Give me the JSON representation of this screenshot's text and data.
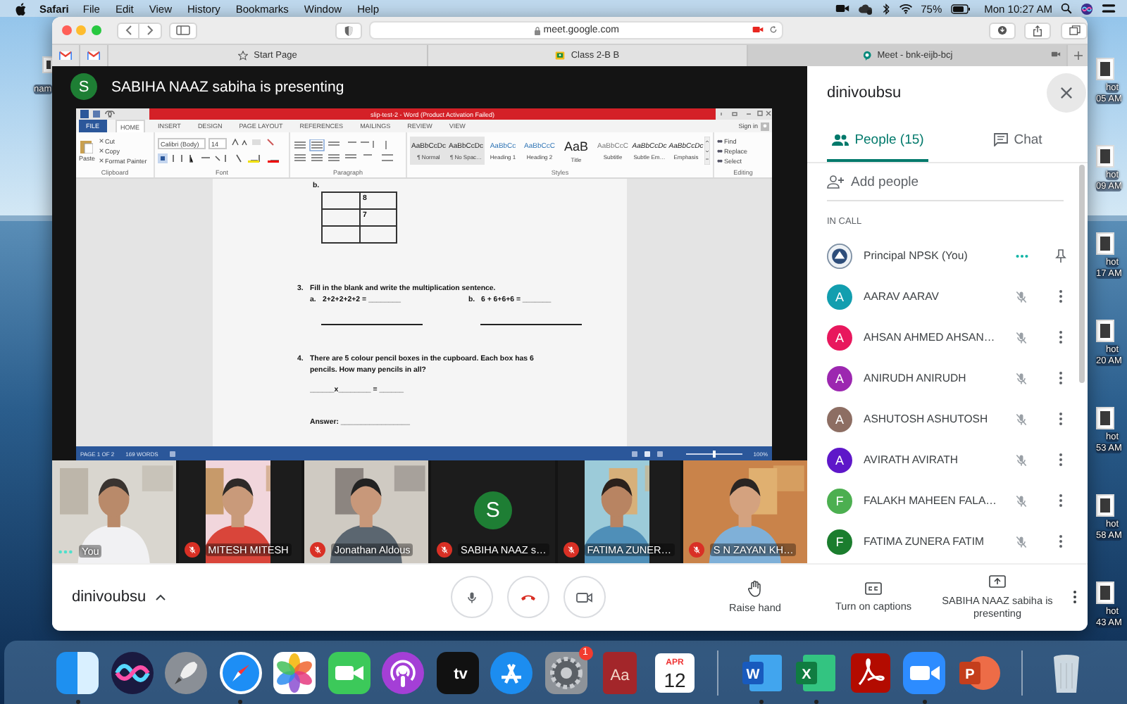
{
  "menu_bar": {
    "app": "Safari",
    "items": [
      "File",
      "Edit",
      "View",
      "History",
      "Bookmarks",
      "Window",
      "Help"
    ],
    "battery": "75%",
    "clock": "Mon 10:27 AM"
  },
  "desktop": {
    "left_labels": [
      "nam"
    ],
    "right_labels": [
      [
        "hot",
        "05 AM"
      ],
      [
        "hot",
        "09 AM"
      ],
      [
        "hot",
        "17 AM"
      ],
      [
        "hot",
        "20 AM"
      ],
      [
        "hot",
        "53 AM"
      ],
      [
        "hot",
        "58 AM"
      ],
      [
        "hot",
        "43 AM"
      ]
    ]
  },
  "browser": {
    "address": "meet.google.com",
    "camera_in_use": true,
    "pinned_tabs": [
      {
        "kind": "gmail"
      },
      {
        "kind": "gmail"
      }
    ],
    "tabs": [
      {
        "title": "Start Page",
        "kind": "start",
        "selected": false
      },
      {
        "title": "Class 2-B B",
        "kind": "classroom",
        "selected": false
      },
      {
        "title": "Meet - bnk-eijb-bcj",
        "kind": "meet",
        "selected": true
      }
    ]
  },
  "presenting_banner": {
    "initial": "S",
    "color": "#1e7e34",
    "text": "SABIHA NAAZ sabiha is presenting"
  },
  "shared_screen": {
    "title": "slip-test-2 - Word (Product Activation Failed)",
    "tabs": [
      {
        "label": "FILE",
        "kind": "file",
        "selected": false
      },
      {
        "label": "HOME",
        "kind": "tab",
        "selected": true
      },
      {
        "label": "INSERT",
        "kind": "tab",
        "selected": false
      },
      {
        "label": "DESIGN",
        "kind": "tab",
        "selected": false
      },
      {
        "label": "PAGE LAYOUT",
        "kind": "tab",
        "selected": false
      },
      {
        "label": "REFERENCES",
        "kind": "tab",
        "selected": false
      },
      {
        "label": "MAILINGS",
        "kind": "tab",
        "selected": false
      },
      {
        "label": "REVIEW",
        "kind": "tab",
        "selected": false
      },
      {
        "label": "VIEW",
        "kind": "tab",
        "selected": false
      }
    ],
    "sign_in": "Sign in",
    "clipboard": {
      "paste": "Paste",
      "tools": [
        "Cut",
        "Copy",
        "Format Painter"
      ],
      "label": "Clipboard"
    },
    "font": {
      "name": "Calibri (Body)",
      "size": "14",
      "label": "Font"
    },
    "paragraph": {
      "label": "Paragraph"
    },
    "styles": {
      "label": "Styles",
      "items": [
        {
          "sample": "AaBbCcDc",
          "name": "¶ Normal",
          "kind": "body"
        },
        {
          "sample": "AaBbCcDc",
          "name": "¶ No Spac…",
          "kind": "body"
        },
        {
          "sample": "AaBbCc",
          "name": "Heading 1",
          "kind": "heading"
        },
        {
          "sample": "AaBbCcC",
          "name": "Heading 2",
          "kind": "heading"
        },
        {
          "sample": "AaB",
          "name": "Title",
          "kind": "title"
        },
        {
          "sample": "AaBbCcC",
          "name": "Subtitle",
          "kind": "subtle"
        },
        {
          "sample": "AaBbCcDc",
          "name": "Subtle Em…",
          "kind": "emphasis"
        },
        {
          "sample": "AaBbCcDc",
          "name": "Emphasis",
          "kind": "emphasis"
        }
      ]
    },
    "editing": {
      "label": "Editing",
      "tools": [
        "Find",
        "Replace",
        "Select"
      ]
    },
    "document": {
      "heading": "b.",
      "table_values": [
        "8",
        "7"
      ],
      "questions": [
        {
          "number": "3.",
          "kind": "blanks",
          "text": "Fill in the blank and write the multiplication sentence.",
          "parts": [
            {
              "label": "a.",
              "text": "2+2+2+2+2 = ________"
            },
            {
              "label": "b.",
              "text": "6 + 6+6+6 = _______"
            }
          ]
        },
        {
          "number": "4.",
          "kind": "word_problem",
          "text": "There are 5 colour pencil boxes in the cupboard. Each box has 6 pencils. How many pencils in all?",
          "equation": "______x________ = ______",
          "answer": "Answer: _________________"
        }
      ]
    },
    "status": {
      "page": "PAGE 1 OF 2",
      "words": "169 WORDS",
      "zoom": "100%",
      "zoom_slider": {
        "level": 0.5
      }
    }
  },
  "tiles": [
    {
      "name": "You",
      "kind": "video",
      "muted": false
    },
    {
      "name": "MITESH MITESH",
      "kind": "portrait",
      "muted": true
    },
    {
      "name": "Jonathan Aldous",
      "kind": "video",
      "muted": true
    },
    {
      "name": "SABIHA NAAZ s…",
      "kind": "avatar",
      "initial": "S",
      "color": "#1e7e34",
      "muted": true
    },
    {
      "name": "FATIMA ZUNER…",
      "kind": "portrait",
      "muted": true
    },
    {
      "name": "S N ZAYAN KH…",
      "kind": "video",
      "muted": true
    }
  ],
  "panel": {
    "title": "dinivoubsu",
    "tabs": [
      {
        "label": "People (15)",
        "kind": "people",
        "selected": true
      },
      {
        "label": "Chat",
        "kind": "chat",
        "selected": false
      }
    ],
    "add_people": "Add people",
    "section": "IN CALL",
    "participants": [
      {
        "name": "Principal NPSK (You)",
        "kind": "self"
      },
      {
        "name": "AARAV AARAV",
        "kind": "member",
        "initial": "A",
        "color": "#129eaf",
        "muted": true
      },
      {
        "name": "AHSAN AHMED AHSAN…",
        "kind": "member",
        "initial": "A",
        "color": "#e8175d",
        "muted": true
      },
      {
        "name": "ANIRUDH ANIRUDH",
        "kind": "member",
        "initial": "A",
        "color": "#9c27b0",
        "muted": true
      },
      {
        "name": "ASHUTOSH ASHUTOSH",
        "kind": "member",
        "initial": "A",
        "color": "#8d6e63",
        "muted": true
      },
      {
        "name": "AVIRATH AVIRATH",
        "kind": "member",
        "initial": "A",
        "color": "#5e17c9",
        "muted": true
      },
      {
        "name": "FALAKH MAHEEN FALA…",
        "kind": "member",
        "initial": "F",
        "color": "#4caf50",
        "muted": true
      },
      {
        "name": "FATIMA ZUNERA FATIM",
        "kind": "member",
        "initial": "F",
        "color": "#1b7d2e",
        "muted": true
      }
    ]
  },
  "call_bar": {
    "meeting": "dinivoubsu",
    "controls": [
      {
        "kind": "mic"
      },
      {
        "kind": "hangup"
      },
      {
        "kind": "camera"
      }
    ],
    "actions": [
      {
        "kind": "hand",
        "label": "Raise hand"
      },
      {
        "kind": "captions",
        "label": "Turn on captions"
      },
      {
        "kind": "present",
        "label": "SABIHA NAAZ sabiha is presenting"
      }
    ]
  },
  "dock": [
    {
      "kind": "finder",
      "running": true
    },
    {
      "kind": "siri",
      "running": false
    },
    {
      "kind": "launchpad",
      "running": false
    },
    {
      "kind": "safari",
      "running": true
    },
    {
      "kind": "photos",
      "running": false
    },
    {
      "kind": "facetime",
      "running": false
    },
    {
      "kind": "podcasts",
      "running": false
    },
    {
      "kind": "tv",
      "glyph": "tv",
      "running": false
    },
    {
      "kind": "appstore",
      "running": false
    },
    {
      "kind": "settings",
      "badge": "1",
      "running": false
    },
    {
      "kind": "dictionary",
      "glyph": "Aa",
      "running": false
    },
    {
      "kind": "calendar",
      "month": "APR",
      "day": "12",
      "running": false
    },
    {
      "kind": "separator"
    },
    {
      "kind": "word",
      "glyph": "W",
      "running": true
    },
    {
      "kind": "excel",
      "glyph": "X",
      "running": true
    },
    {
      "kind": "acrobat",
      "running": false
    },
    {
      "kind": "zoom",
      "running": true
    },
    {
      "kind": "powerpoint",
      "glyph": "P",
      "running": false
    },
    {
      "kind": "separator"
    },
    {
      "kind": "trash",
      "running": false
    }
  ]
}
